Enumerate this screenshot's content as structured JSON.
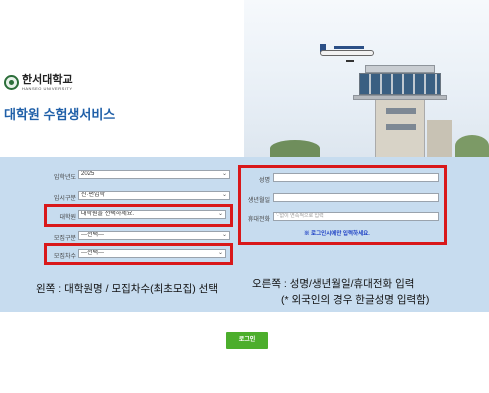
{
  "header": {
    "university_name": "한서대학교",
    "university_eng": "HANSEO UNIVERSITY",
    "service_title": "대학원 수험생서비스"
  },
  "form_left": {
    "year": {
      "label": "입학년도",
      "value": "2025"
    },
    "admission_type": {
      "label": "입시구분",
      "value": "신·편입학"
    },
    "graduate_school": {
      "label": "대학원",
      "value": "대학원을 선택하세요."
    },
    "recruit_type": {
      "label": "모집구분",
      "value": "---선택---"
    },
    "recruit_round": {
      "label": "모집차수",
      "value": "---선택---"
    }
  },
  "form_right": {
    "name": {
      "label": "성명",
      "value": ""
    },
    "birthdate": {
      "label": "생년월일",
      "value": ""
    },
    "phone": {
      "label": "휴대전화",
      "placeholder": "'-'없이 연속적으로 입력"
    },
    "notice": "※ 로그인시에만 입력하세요."
  },
  "captions": {
    "left": "왼쪽 : 대학원명 / 모집차수(최초모집) 선택",
    "right_line1": "오른쪽 : 성명/생년월일/휴대전화 입력",
    "right_line2": "(* 외국인의 경우 한글성명 입력함)"
  },
  "login_button": "로그인",
  "colors": {
    "band": "#c7dcef",
    "highlight": "#d9181a",
    "title_blue": "#1f5fa8",
    "button_green": "#4cae2c"
  },
  "icons": [
    "university-emblem-icon",
    "airplane-illustration",
    "control-tower-illustration"
  ]
}
